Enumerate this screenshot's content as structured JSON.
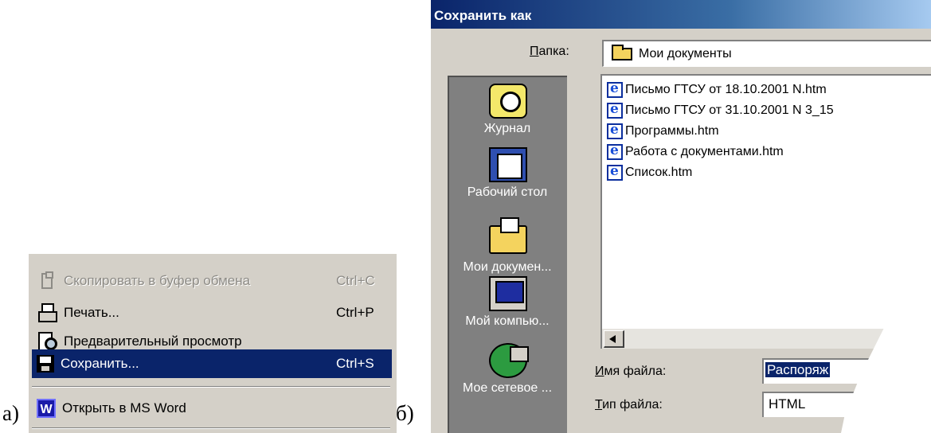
{
  "captions": {
    "a": "а)",
    "b": "б)"
  },
  "menu": {
    "items": [
      {
        "label": "Скопировать в буфер обмена",
        "shortcut": "Ctrl+C",
        "icon": "clipboard-icon",
        "state": "disabled"
      },
      {
        "label": "Печать...",
        "shortcut": "Ctrl+P",
        "icon": "printer-icon",
        "state": "normal"
      },
      {
        "label": "Предварительный просмотр",
        "shortcut": "",
        "icon": "print-preview-icon",
        "state": "normal"
      },
      {
        "label": "Сохранить...",
        "shortcut": "Ctrl+S",
        "icon": "floppy-disk-icon",
        "state": "selected"
      },
      {
        "label": "Открыть в MS Word",
        "shortcut": "",
        "icon": "ms-word-icon",
        "state": "normal"
      }
    ],
    "word_icon_letter": "W"
  },
  "dialog": {
    "title": "Сохранить как",
    "folder_label_mnemonic": "П",
    "folder_label_rest": "апка:",
    "folder_value": "Мои документы",
    "places": [
      {
        "label": "Журнал",
        "icon": "history-icon"
      },
      {
        "label": "Рабочий стол",
        "icon": "desktop-icon"
      },
      {
        "label": "Мои докумен...",
        "icon": "my-documents-icon"
      },
      {
        "label": "Мой компью...",
        "icon": "my-computer-icon"
      },
      {
        "label": "Мое сетевое ...",
        "icon": "network-places-icon"
      }
    ],
    "files": [
      "Письмо ГТСУ от 18.10.2001 N.htm",
      "Письмо ГТСУ от 31.10.2001 N 3_15",
      "Программы.htm",
      "Работа с документами.htm",
      "Список.htm"
    ],
    "filename_label_mnemonic": "И",
    "filename_label_rest": "мя файла:",
    "filename_value": "Распоряж",
    "filetype_label_mnemonic": "Т",
    "filetype_label_rest": "ип файла:",
    "filetype_value": "HTML"
  },
  "colors": {
    "selection": "#0a246a",
    "face": "#d4d0c8",
    "places_bar": "#808080"
  }
}
